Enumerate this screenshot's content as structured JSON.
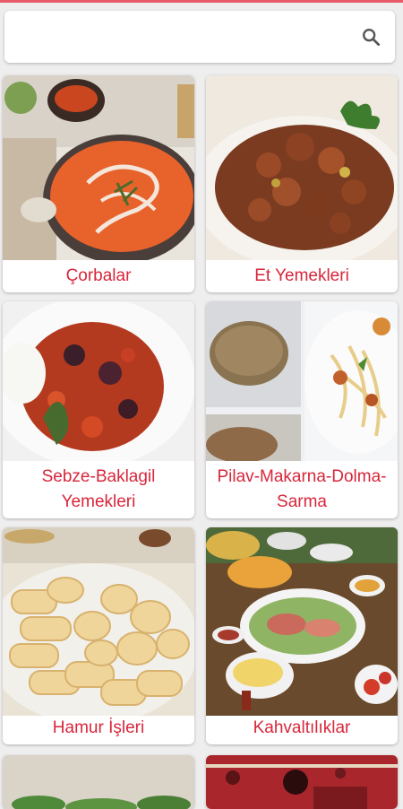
{
  "search": {
    "placeholder": "",
    "value": ""
  },
  "categories": [
    {
      "label": "Çorbalar"
    },
    {
      "label": "Et Yemekleri"
    },
    {
      "label": "Sebze-Baklagil Yemekleri"
    },
    {
      "label": "Pilav-Makarna-Dolma-Sarma"
    },
    {
      "label": "Hamur İşleri"
    },
    {
      "label": "Kahvaltılıklar"
    }
  ],
  "colors": {
    "accent": "#d8263b",
    "background": "#efeeee",
    "card": "#ffffff"
  },
  "icons": {
    "search": "search-icon"
  }
}
